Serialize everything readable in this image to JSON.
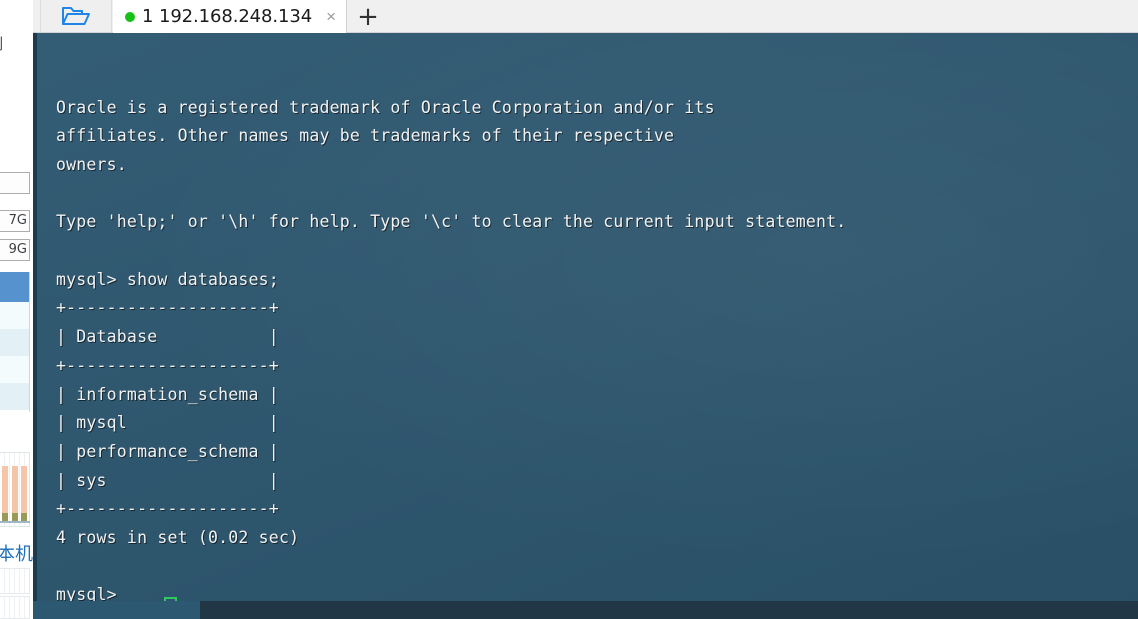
{
  "window": {
    "tabbar": {
      "folder_icon": "open-folder-icon",
      "tab": {
        "status_dot": "connected-dot",
        "label": "1 192.168.248.134",
        "close_icon": "×"
      },
      "new_tab_icon": "+"
    }
  },
  "left_panel": {
    "clipped_label_top": "制",
    "fields": [
      {
        "value": ""
      },
      {
        "value": "7G"
      },
      {
        "value": "9G"
      }
    ],
    "clipped_label_bottom": "本机"
  },
  "terminal": {
    "background_color": "#2d5871",
    "text_color": "#f2f2f2",
    "cursor_color": "#2fcb5e",
    "lines": [
      "Oracle is a registered trademark of Oracle Corporation and/or its",
      "affiliates. Other names may be trademarks of their respective",
      "owners.",
      "",
      "Type 'help;' or '\\h' for help. Type '\\c' to clear the current input statement.",
      "",
      "mysql> show databases;",
      "+--------------------+",
      "| Database           |",
      "+--------------------+",
      "| information_schema |",
      "| mysql              |",
      "| performance_schema |",
      "| sys                |",
      "+--------------------+",
      "4 rows in set (0.02 sec)",
      "",
      "mysql> "
    ]
  }
}
